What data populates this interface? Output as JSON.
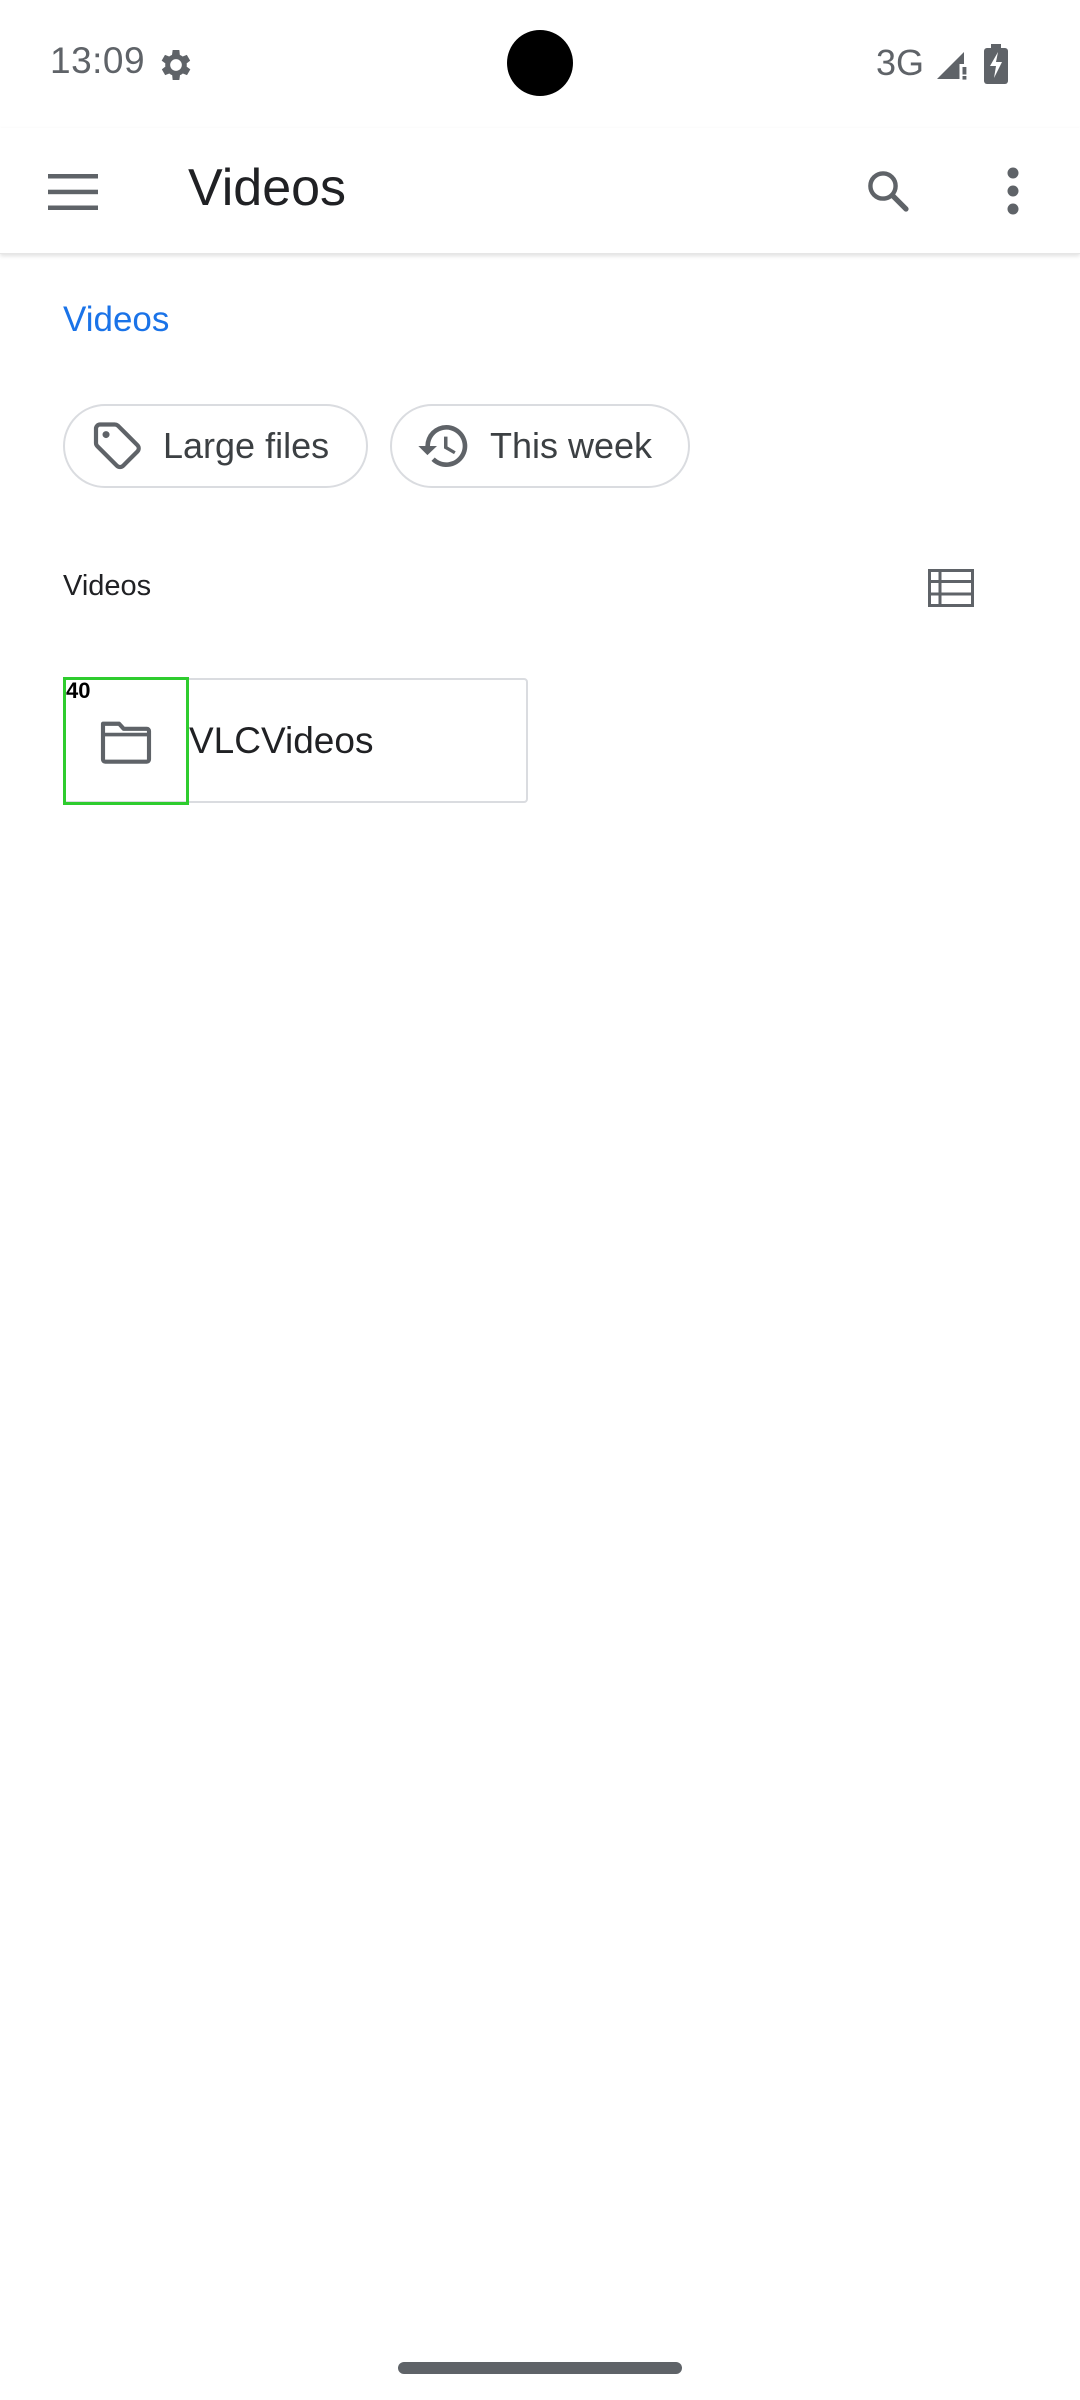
{
  "status": {
    "time": "13:09",
    "network": "3G",
    "icons": [
      "settings-gear-icon",
      "signal-icon",
      "battery-charging-icon"
    ]
  },
  "app_bar": {
    "title": "Videos",
    "menu_icon": "hamburger-menu-icon",
    "search_icon": "search-icon",
    "more_icon": "more-vert-icon"
  },
  "breadcrumb": {
    "label": "Videos"
  },
  "chips": [
    {
      "label": "Large files",
      "icon": "tag-icon"
    },
    {
      "label": "This week",
      "icon": "history-icon"
    }
  ],
  "section": {
    "title": "Videos",
    "view_toggle_icon": "list-view-icon"
  },
  "folders": [
    {
      "name": "VLCVideos",
      "icon": "folder-icon",
      "marker": "40"
    }
  ],
  "colors": {
    "accent": "#1a73e8",
    "text": "#202124",
    "icon": "#5f6368",
    "outline": "#dadce0",
    "highlight": "#2ecc2e"
  }
}
